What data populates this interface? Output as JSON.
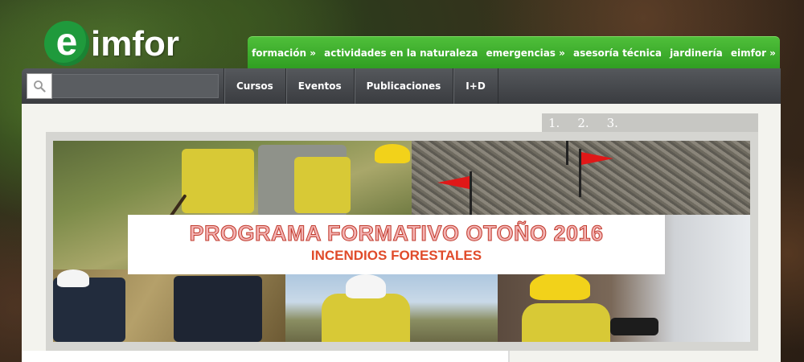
{
  "logo": {
    "letter": "e",
    "text": "imfor"
  },
  "main_nav": [
    {
      "label": "formación »"
    },
    {
      "label": "actividades en la naturaleza"
    },
    {
      "label": "emergencias »"
    },
    {
      "label": "asesoría técnica"
    },
    {
      "label": "jardinería"
    },
    {
      "label": "eimfor »"
    }
  ],
  "search": {
    "placeholder": ""
  },
  "sub_nav": [
    {
      "label": "Cursos"
    },
    {
      "label": "Eventos"
    },
    {
      "label": "Publicaciones"
    },
    {
      "label": "I+D"
    }
  ],
  "slider": {
    "pages": [
      "1.",
      "2.",
      "3."
    ],
    "title": "PROGRAMA FORMATIVO OTOÑO 2016",
    "subtitle": "INCENDIOS FORESTALES"
  },
  "colors": {
    "nav_green": "#3aaa2a",
    "dark_bar": "#45484c",
    "logo_green": "#1f9a3c",
    "title_red": "#c0392b"
  }
}
